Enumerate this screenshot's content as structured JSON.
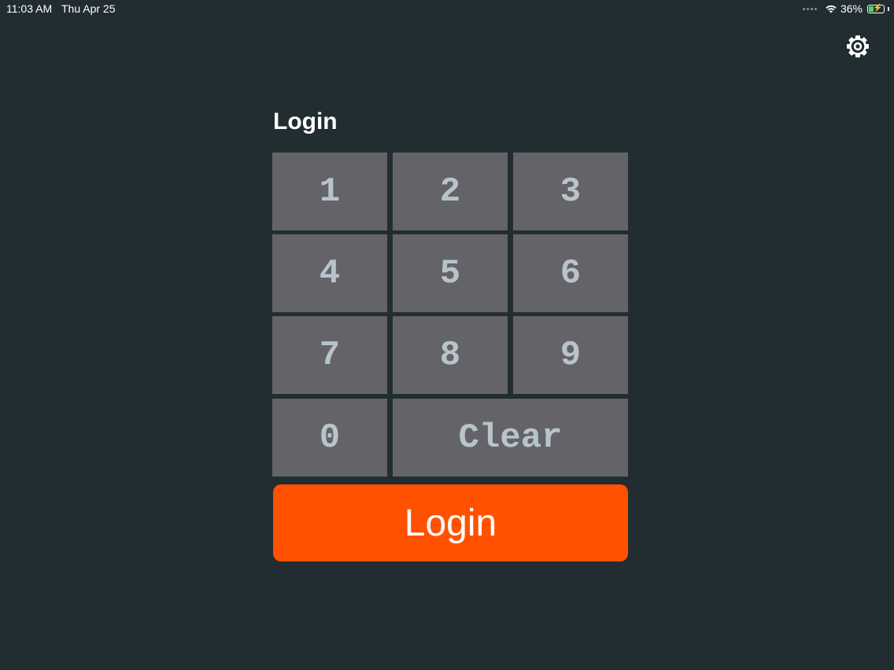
{
  "status_bar": {
    "time": "11:03 AM",
    "date": "Thu Apr 25",
    "battery_percent": "36%",
    "battery_level": 0.36,
    "battery_charging": true,
    "battery_color": "#4cd964"
  },
  "settings": {
    "icon": "gear-icon"
  },
  "login": {
    "title": "Login",
    "keys": {
      "k1": "1",
      "k2": "2",
      "k3": "3",
      "k4": "4",
      "k5": "5",
      "k6": "6",
      "k7": "7",
      "k8": "8",
      "k9": "9",
      "k0": "0",
      "clear": "Clear"
    },
    "submit_label": "Login"
  },
  "colors": {
    "background": "#222d31",
    "key_background": "#646468",
    "key_text": "#b7c4cc",
    "accent": "#ff5100"
  }
}
